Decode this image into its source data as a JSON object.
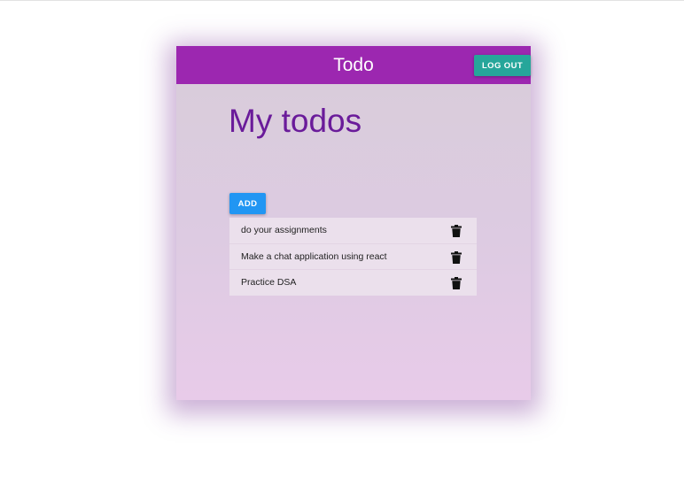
{
  "appbar": {
    "title": "Todo",
    "logout_label": "LOG OUT"
  },
  "main": {
    "page_title": "My todos",
    "input": {
      "value": "",
      "placeholder": ""
    },
    "add_label": "ADD"
  },
  "todos": [
    {
      "text": "do your assignments",
      "action_icon": "trash-icon"
    },
    {
      "text": "Make a chat application using react",
      "action_icon": "trash-icon"
    },
    {
      "text": "Practice DSA",
      "action_icon": "trash-icon"
    }
  ],
  "colors": {
    "appbar": "#9c27b0",
    "title": "#6a1b9a",
    "logout_button": "#26a69a",
    "add_button": "#2196f3",
    "input_underline": "#26a69a"
  }
}
